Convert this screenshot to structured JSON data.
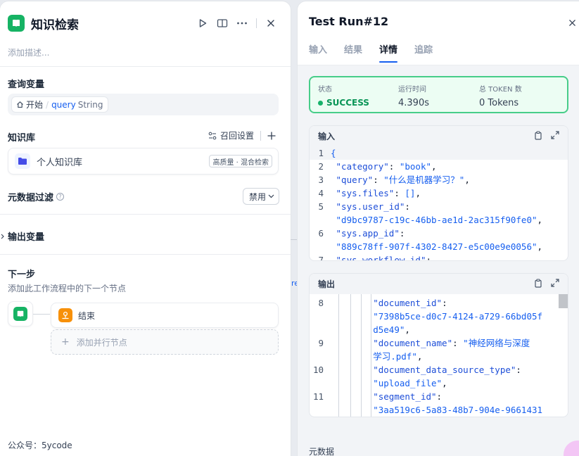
{
  "left_panel": {
    "title": "知识检索",
    "description_placeholder": "添加描述...",
    "query_var": {
      "section_title": "查询变量",
      "node": "开始",
      "separator": "/",
      "variable": "query",
      "type": "String"
    },
    "knowledge": {
      "section_title": "知识库",
      "recall_settings": "召回设置",
      "items": [
        {
          "name": "个人知识库",
          "badge": "高质量 · 混合检索"
        }
      ]
    },
    "metadata_filter": {
      "label": "元数据过滤",
      "value": "禁用"
    },
    "output_vars": "输出变量",
    "next_step": {
      "title": "下一步",
      "subtitle": "添加此工作流程中的下一个节点",
      "end_node": "结束",
      "add_parallel": "添加并行节点"
    },
    "footer": "公众号：5ycode"
  },
  "canvas_fragment": "re",
  "right_panel": {
    "title": "Test Run#12",
    "tabs": [
      "输入",
      "结果",
      "详情",
      "追踪"
    ],
    "active_tab": "详情",
    "status": {
      "label": "状态",
      "value": "SUCCESS",
      "runtime_label": "运行时间",
      "runtime": "4.390s",
      "tokens_label": "总 TOKEN 数",
      "tokens": "0 Tokens"
    },
    "input_panel": {
      "title": "输入",
      "lines": [
        {
          "n": "1",
          "text": "{"
        },
        {
          "n": "2",
          "key": "\"category\"",
          "val": "\"book\"",
          "tail": ","
        },
        {
          "n": "3",
          "key": "\"query\"",
          "val": "\"什么是机器学习？\"",
          "tail": ","
        },
        {
          "n": "4",
          "key": "\"sys.files\"",
          "val": "[]",
          "tail": ","
        },
        {
          "n": "5",
          "key": "\"sys.user_id\"",
          "tail": ":"
        },
        {
          "n": "",
          "val": "\"d9bc9787-c19c-46bb-ae1d-2ac315f90fe0\"",
          "tail": ","
        },
        {
          "n": "6",
          "key": "\"sys.app_id\"",
          "tail": ":"
        },
        {
          "n": "",
          "val": "\"889c78ff-907f-4302-8427-e5c00e9e0056\"",
          "tail": ","
        },
        {
          "n": "7",
          "key": "\"sys.workflow_id\"",
          "tail": ":"
        }
      ]
    },
    "output_panel": {
      "title": "输出",
      "lines": [
        {
          "n": "8",
          "key": "\"document_id\"",
          "tail": ":"
        },
        {
          "n": "",
          "val": "\"7398b5ce-d0c7-4124-a729-66bd05f"
        },
        {
          "n": "",
          "val": "d5e49\"",
          "tail": ","
        },
        {
          "n": "9",
          "key": "\"document_name\"",
          "val": "\"神经网络与深度"
        },
        {
          "n": "",
          "val": "学习.pdf\"",
          "tail": ","
        },
        {
          "n": "10",
          "key": "\"document_data_source_type\"",
          "tail": ":"
        },
        {
          "n": "",
          "val": "\"upload_file\"",
          "tail": ","
        },
        {
          "n": "11",
          "key": "\"segment_id\"",
          "tail": ":"
        },
        {
          "n": "",
          "val": "\"3aa519c6-5a83-48b7-904e-9661431"
        }
      ]
    },
    "metadata_label": "元数据"
  }
}
